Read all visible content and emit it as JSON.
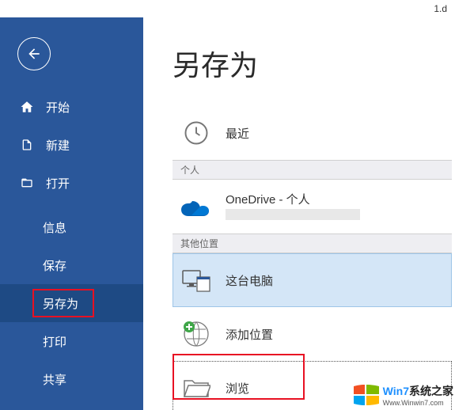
{
  "titlebar": {
    "filename": "1.d"
  },
  "sidebar": {
    "nav": {
      "home": "开始",
      "new": "新建",
      "open": "打开"
    },
    "sub": {
      "info": "信息",
      "save": "保存",
      "saveas": "另存为",
      "print": "打印",
      "share": "共享"
    }
  },
  "main": {
    "title": "另存为",
    "recent": "最近",
    "section_personal": "个人",
    "onedrive": {
      "primary": "OneDrive - 个人",
      "secondary": " "
    },
    "section_other": "其他位置",
    "thispc": "这台电脑",
    "addplace": "添加位置",
    "browse": "浏览"
  },
  "watermark": {
    "brand1": "Win7",
    "brand2": "系统之家",
    "url": "Www.Winwin7.com"
  }
}
